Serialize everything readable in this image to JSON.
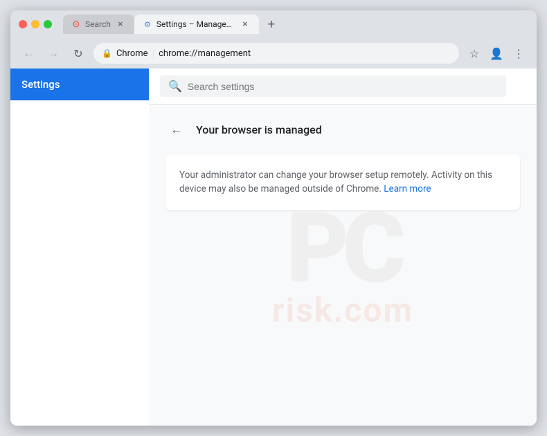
{
  "browser": {
    "tabs": [
      {
        "id": "tab-search",
        "label": "Search",
        "favicon_type": "search",
        "active": false
      },
      {
        "id": "tab-settings",
        "label": "Settings – Management",
        "favicon_type": "settings",
        "active": true
      }
    ],
    "new_tab_label": "+",
    "address": {
      "chrome_label": "Chrome",
      "url": "chrome://management",
      "lock_symbol": "🔒"
    }
  },
  "toolbar": {
    "bookmark_icon": "☆",
    "account_icon": "👤",
    "menu_icon": "⋮"
  },
  "nav": {
    "back_arrow": "←",
    "forward_arrow": "→",
    "reload_icon": "↻"
  },
  "sidebar": {
    "title": "Settings"
  },
  "search": {
    "placeholder": "Search settings"
  },
  "page": {
    "back_label": "←",
    "title": "Your browser is managed",
    "info_text": "Your administrator can change your browser setup remotely. Activity on this device may also be managed outside of Chrome.",
    "learn_more_label": "Learn more"
  }
}
